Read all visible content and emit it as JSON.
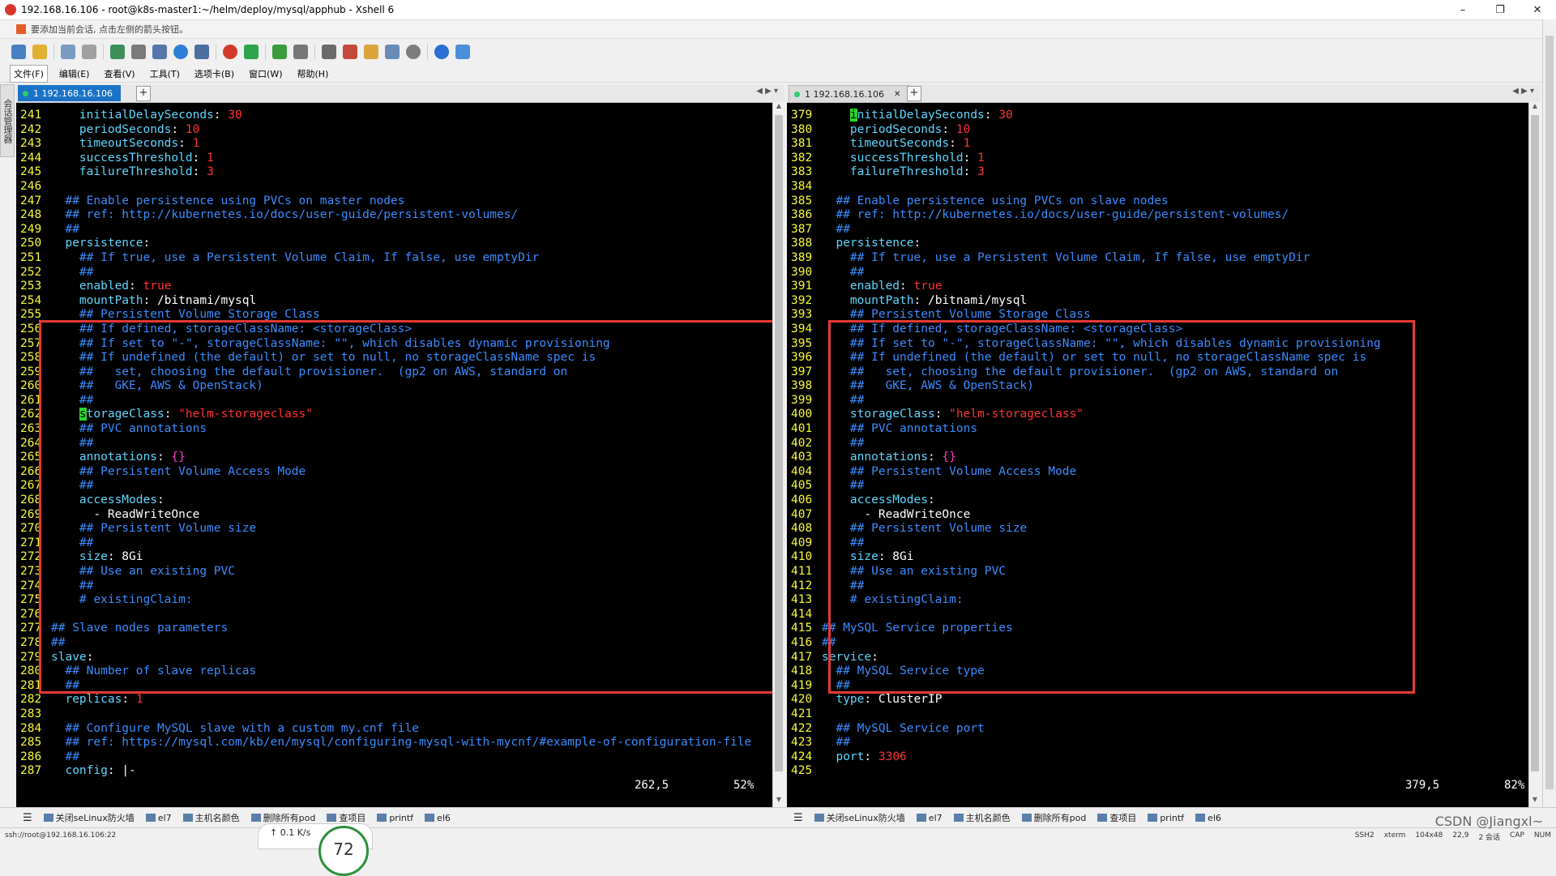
{
  "window": {
    "title": "192.168.16.106 - root@k8s-master1:~/helm/deploy/mysql/apphub - Xshell 6",
    "minimize": "–",
    "maximize": "❐",
    "close": "✕"
  },
  "hint": "要添加当前会话, 点击左侧的箭头按钮。",
  "menu": [
    "文件(F)",
    "编辑(E)",
    "查看(V)",
    "工具(T)",
    "选项卡(B)",
    "窗口(W)",
    "帮助(H)"
  ],
  "side_tab": "会话管理器",
  "left": {
    "tab_label": "1 192.168.16.106",
    "status": "262,5",
    "percent": "52%",
    "lines": [
      {
        "n": "241",
        "t": [
          [
            "w",
            "    "
          ],
          [
            "k",
            "initialDelaySeconds"
          ],
          [
            "w",
            ": "
          ],
          [
            "v",
            "30"
          ]
        ]
      },
      {
        "n": "242",
        "t": [
          [
            "w",
            "    "
          ],
          [
            "k",
            "periodSeconds"
          ],
          [
            "w",
            ": "
          ],
          [
            "v",
            "10"
          ]
        ]
      },
      {
        "n": "243",
        "t": [
          [
            "w",
            "    "
          ],
          [
            "k",
            "timeoutSeconds"
          ],
          [
            "w",
            ": "
          ],
          [
            "v",
            "1"
          ]
        ]
      },
      {
        "n": "244",
        "t": [
          [
            "w",
            "    "
          ],
          [
            "k",
            "successThreshold"
          ],
          [
            "w",
            ": "
          ],
          [
            "v",
            "1"
          ]
        ]
      },
      {
        "n": "245",
        "t": [
          [
            "w",
            "    "
          ],
          [
            "k",
            "failureThreshold"
          ],
          [
            "w",
            ": "
          ],
          [
            "v",
            "3"
          ]
        ]
      },
      {
        "n": "246",
        "t": []
      },
      {
        "n": "247",
        "t": [
          [
            "c",
            "  ## Enable persistence using PVCs on master nodes"
          ]
        ]
      },
      {
        "n": "248",
        "t": [
          [
            "c",
            "  ## ref: http://kubernetes.io/docs/user-guide/persistent-volumes/"
          ]
        ]
      },
      {
        "n": "249",
        "t": [
          [
            "c",
            "  ##"
          ]
        ]
      },
      {
        "n": "250",
        "t": [
          [
            "w",
            "  "
          ],
          [
            "k",
            "persistence"
          ],
          [
            "w",
            ":"
          ]
        ]
      },
      {
        "n": "251",
        "t": [
          [
            "c",
            "    ## If true, use a Persistent Volume Claim, If false, use emptyDir"
          ]
        ]
      },
      {
        "n": "252",
        "t": [
          [
            "c",
            "    ##"
          ]
        ]
      },
      {
        "n": "253",
        "t": [
          [
            "w",
            "    "
          ],
          [
            "k",
            "enabled"
          ],
          [
            "w",
            ": "
          ],
          [
            "v",
            "true"
          ]
        ]
      },
      {
        "n": "254",
        "t": [
          [
            "w",
            "    "
          ],
          [
            "k",
            "mountPath"
          ],
          [
            "w",
            ": /bitnami/mysql"
          ]
        ]
      },
      {
        "n": "255",
        "t": [
          [
            "c",
            "    ## Persistent Volume Storage Class"
          ]
        ]
      },
      {
        "n": "256",
        "t": [
          [
            "c",
            "    ## If defined, storageClassName: <storageClass>"
          ]
        ]
      },
      {
        "n": "257",
        "t": [
          [
            "c",
            "    ## If set to \"-\", storageClassName: \"\", which disables dynamic provisioning"
          ]
        ]
      },
      {
        "n": "258",
        "t": [
          [
            "c",
            "    ## If undefined (the default) or set to null, no storageClassName spec is"
          ]
        ]
      },
      {
        "n": "259",
        "t": [
          [
            "c",
            "    ##   set, choosing the default provisioner.  (gp2 on AWS, standard on"
          ]
        ]
      },
      {
        "n": "260",
        "t": [
          [
            "c",
            "    ##   GKE, AWS & OpenStack)"
          ]
        ]
      },
      {
        "n": "261",
        "t": [
          [
            "c",
            "    ##"
          ]
        ]
      },
      {
        "n": "262",
        "t": [
          [
            "w",
            "    "
          ],
          [
            "cursor",
            "s"
          ],
          [
            "k",
            "torageClass"
          ],
          [
            "w",
            ": "
          ],
          [
            "v",
            "\"helm-storageclass\""
          ]
        ]
      },
      {
        "n": "263",
        "t": [
          [
            "c",
            "    ## PVC annotations"
          ]
        ]
      },
      {
        "n": "264",
        "t": [
          [
            "c",
            "    ##"
          ]
        ]
      },
      {
        "n": "265",
        "t": [
          [
            "w",
            "    "
          ],
          [
            "k",
            "annotations"
          ],
          [
            "w",
            ": "
          ],
          [
            "m",
            "{}"
          ]
        ]
      },
      {
        "n": "266",
        "t": [
          [
            "c",
            "    ## Persistent Volume Access Mode"
          ]
        ]
      },
      {
        "n": "267",
        "t": [
          [
            "c",
            "    ##"
          ]
        ]
      },
      {
        "n": "268",
        "t": [
          [
            "w",
            "    "
          ],
          [
            "k",
            "accessModes"
          ],
          [
            "w",
            ":"
          ]
        ]
      },
      {
        "n": "269",
        "t": [
          [
            "w",
            "      - ReadWriteOnce"
          ]
        ]
      },
      {
        "n": "270",
        "t": [
          [
            "c",
            "    ## Persistent Volume size"
          ]
        ]
      },
      {
        "n": "271",
        "t": [
          [
            "c",
            "    ##"
          ]
        ]
      },
      {
        "n": "272",
        "t": [
          [
            "w",
            "    "
          ],
          [
            "k",
            "size"
          ],
          [
            "w",
            ": 8Gi"
          ]
        ]
      },
      {
        "n": "273",
        "t": [
          [
            "c",
            "    ## Use an existing PVC"
          ]
        ]
      },
      {
        "n": "274",
        "t": [
          [
            "c",
            "    ##"
          ]
        ]
      },
      {
        "n": "275",
        "t": [
          [
            "c",
            "    # existingClaim:"
          ]
        ]
      },
      {
        "n": "276",
        "t": []
      },
      {
        "n": "277",
        "t": [
          [
            "c",
            "## Slave nodes parameters"
          ]
        ]
      },
      {
        "n": "278",
        "t": [
          [
            "c",
            "##"
          ]
        ]
      },
      {
        "n": "279",
        "t": [
          [
            "k",
            "slave"
          ],
          [
            "w",
            ":"
          ]
        ]
      },
      {
        "n": "280",
        "t": [
          [
            "c",
            "  ## Number of slave replicas"
          ]
        ]
      },
      {
        "n": "281",
        "t": [
          [
            "c",
            "  ##"
          ]
        ]
      },
      {
        "n": "282",
        "t": [
          [
            "w",
            "  "
          ],
          [
            "k",
            "replicas"
          ],
          [
            "w",
            ": "
          ],
          [
            "v",
            "1"
          ]
        ]
      },
      {
        "n": "283",
        "t": []
      },
      {
        "n": "284",
        "t": [
          [
            "c",
            "  ## Configure MySQL slave with a custom my.cnf file"
          ]
        ]
      },
      {
        "n": "285",
        "t": [
          [
            "c",
            "  ## ref: https://mysql.com/kb/en/mysql/configuring-mysql-with-mycnf/#example-of-configuration-file"
          ]
        ]
      },
      {
        "n": "286",
        "t": [
          [
            "c",
            "  ##"
          ]
        ]
      },
      {
        "n": "287",
        "t": [
          [
            "w",
            "  "
          ],
          [
            "k",
            "config"
          ],
          [
            "w",
            ": |-"
          ]
        ]
      }
    ]
  },
  "right": {
    "tab_label": "1 192.168.16.106",
    "status": "379,5",
    "percent": "82%",
    "lines": [
      {
        "n": "379",
        "t": [
          [
            "w",
            "    "
          ],
          [
            "cursor",
            "i"
          ],
          [
            "k",
            "nitialDelaySeconds"
          ],
          [
            "w",
            ": "
          ],
          [
            "v",
            "30"
          ]
        ]
      },
      {
        "n": "380",
        "t": [
          [
            "w",
            "    "
          ],
          [
            "k",
            "periodSeconds"
          ],
          [
            "w",
            ": "
          ],
          [
            "v",
            "10"
          ]
        ]
      },
      {
        "n": "381",
        "t": [
          [
            "w",
            "    "
          ],
          [
            "k",
            "timeoutSeconds"
          ],
          [
            "w",
            ": "
          ],
          [
            "v",
            "1"
          ]
        ]
      },
      {
        "n": "382",
        "t": [
          [
            "w",
            "    "
          ],
          [
            "k",
            "successThreshold"
          ],
          [
            "w",
            ": "
          ],
          [
            "v",
            "1"
          ]
        ]
      },
      {
        "n": "383",
        "t": [
          [
            "w",
            "    "
          ],
          [
            "k",
            "failureThreshold"
          ],
          [
            "w",
            ": "
          ],
          [
            "v",
            "3"
          ]
        ]
      },
      {
        "n": "384",
        "t": []
      },
      {
        "n": "385",
        "t": [
          [
            "c",
            "  ## Enable persistence using PVCs on slave nodes"
          ]
        ]
      },
      {
        "n": "386",
        "t": [
          [
            "c",
            "  ## ref: http://kubernetes.io/docs/user-guide/persistent-volumes/"
          ]
        ]
      },
      {
        "n": "387",
        "t": [
          [
            "c",
            "  ##"
          ]
        ]
      },
      {
        "n": "388",
        "t": [
          [
            "w",
            "  "
          ],
          [
            "k",
            "persistence"
          ],
          [
            "w",
            ":"
          ]
        ]
      },
      {
        "n": "389",
        "t": [
          [
            "c",
            "    ## If true, use a Persistent Volume Claim, If false, use emptyDir"
          ]
        ]
      },
      {
        "n": "390",
        "t": [
          [
            "c",
            "    ##"
          ]
        ]
      },
      {
        "n": "391",
        "t": [
          [
            "w",
            "    "
          ],
          [
            "k",
            "enabled"
          ],
          [
            "w",
            ": "
          ],
          [
            "v",
            "true"
          ]
        ]
      },
      {
        "n": "392",
        "t": [
          [
            "w",
            "    "
          ],
          [
            "k",
            "mountPath"
          ],
          [
            "w",
            ": /bitnami/mysql"
          ]
        ]
      },
      {
        "n": "393",
        "t": [
          [
            "c",
            "    ## Persistent Volume Storage Class"
          ]
        ]
      },
      {
        "n": "394",
        "t": [
          [
            "c",
            "    ## If defined, storageClassName: <storageClass>"
          ]
        ]
      },
      {
        "n": "395",
        "t": [
          [
            "c",
            "    ## If set to \"-\", storageClassName: \"\", which disables dynamic provisioning"
          ]
        ]
      },
      {
        "n": "396",
        "t": [
          [
            "c",
            "    ## If undefined (the default) or set to null, no storageClassName spec is"
          ]
        ]
      },
      {
        "n": "397",
        "t": [
          [
            "c",
            "    ##   set, choosing the default provisioner.  (gp2 on AWS, standard on"
          ]
        ]
      },
      {
        "n": "398",
        "t": [
          [
            "c",
            "    ##   GKE, AWS & OpenStack)"
          ]
        ]
      },
      {
        "n": "399",
        "t": [
          [
            "c",
            "    ##"
          ]
        ]
      },
      {
        "n": "400",
        "t": [
          [
            "w",
            "    "
          ],
          [
            "k",
            "storageClass"
          ],
          [
            "w",
            ": "
          ],
          [
            "v",
            "\"helm-storageclass\""
          ]
        ]
      },
      {
        "n": "401",
        "t": [
          [
            "c",
            "    ## PVC annotations"
          ]
        ]
      },
      {
        "n": "402",
        "t": [
          [
            "c",
            "    ##"
          ]
        ]
      },
      {
        "n": "403",
        "t": [
          [
            "w",
            "    "
          ],
          [
            "k",
            "annotations"
          ],
          [
            "w",
            ": "
          ],
          [
            "m",
            "{}"
          ]
        ]
      },
      {
        "n": "404",
        "t": [
          [
            "c",
            "    ## Persistent Volume Access Mode"
          ]
        ]
      },
      {
        "n": "405",
        "t": [
          [
            "c",
            "    ##"
          ]
        ]
      },
      {
        "n": "406",
        "t": [
          [
            "w",
            "    "
          ],
          [
            "k",
            "accessModes"
          ],
          [
            "w",
            ":"
          ]
        ]
      },
      {
        "n": "407",
        "t": [
          [
            "w",
            "      - ReadWriteOnce"
          ]
        ]
      },
      {
        "n": "408",
        "t": [
          [
            "c",
            "    ## Persistent Volume size"
          ]
        ]
      },
      {
        "n": "409",
        "t": [
          [
            "c",
            "    ##"
          ]
        ]
      },
      {
        "n": "410",
        "t": [
          [
            "w",
            "    "
          ],
          [
            "k",
            "size"
          ],
          [
            "w",
            ": 8Gi"
          ]
        ]
      },
      {
        "n": "411",
        "t": [
          [
            "c",
            "    ## Use an existing PVC"
          ]
        ]
      },
      {
        "n": "412",
        "t": [
          [
            "c",
            "    ##"
          ]
        ]
      },
      {
        "n": "413",
        "t": [
          [
            "c",
            "    # existingClaim:"
          ]
        ]
      },
      {
        "n": "414",
        "t": []
      },
      {
        "n": "415",
        "t": [
          [
            "c",
            "## MySQL Service properties"
          ]
        ]
      },
      {
        "n": "416",
        "t": [
          [
            "c",
            "##"
          ]
        ]
      },
      {
        "n": "417",
        "t": [
          [
            "k",
            "service"
          ],
          [
            "w",
            ":"
          ]
        ]
      },
      {
        "n": "418",
        "t": [
          [
            "c",
            "  ## MySQL Service type"
          ]
        ]
      },
      {
        "n": "419",
        "t": [
          [
            "c",
            "  ##"
          ]
        ]
      },
      {
        "n": "420",
        "t": [
          [
            "w",
            "  "
          ],
          [
            "k",
            "type"
          ],
          [
            "w",
            ": ClusterIP"
          ]
        ]
      },
      {
        "n": "421",
        "t": []
      },
      {
        "n": "422",
        "t": [
          [
            "c",
            "  ## MySQL Service port"
          ]
        ]
      },
      {
        "n": "423",
        "t": [
          [
            "c",
            "  ##"
          ]
        ]
      },
      {
        "n": "424",
        "t": [
          [
            "w",
            "  "
          ],
          [
            "k",
            "port"
          ],
          [
            "w",
            ": "
          ],
          [
            "v",
            "3306"
          ]
        ]
      },
      {
        "n": "425",
        "t": []
      }
    ]
  },
  "quick_commands": [
    "关闭seLinux防火墙",
    "el7",
    "主机名颜色",
    "删除所有pod",
    "查项目",
    "printf",
    "el6"
  ],
  "statusbar": {
    "left": "ssh://root@192.168.16.106:22",
    "right": [
      "SSH2",
      "xterm",
      "104x48",
      "22,9",
      "2 会话",
      "CAP",
      "NUM"
    ]
  },
  "net_widget": {
    "speed": "↑ 0.1 K/s",
    "value": "72"
  },
  "watermark": "CSDN @Jiangxl~"
}
